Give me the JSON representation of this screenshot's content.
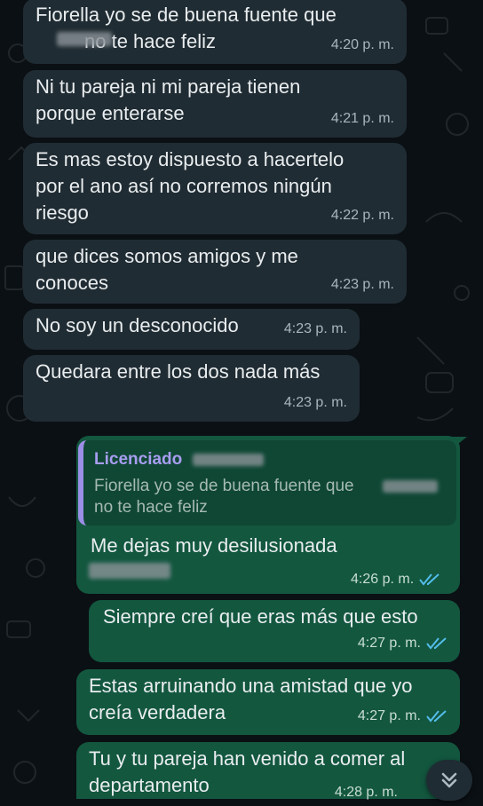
{
  "messages": [
    {
      "text": "Fiorella yo se de buena fuente que\n         no te hace feliz",
      "time": "4:20 p. m."
    },
    {
      "text": "Ni tu pareja ni mi pareja tienen\nporque enterarse",
      "time": "4:21 p. m."
    },
    {
      "text": "Es mas estoy dispuesto a hacertelo\npor el ano así no corremos ningún\nriesgo",
      "time": "4:22 p. m."
    },
    {
      "text": "que dices somos amigos y me\nconoces",
      "time": "4:23 p. m."
    },
    {
      "text": "No soy un desconocido",
      "time": "4:23 p. m."
    },
    {
      "text": "Quedara entre los dos nada más",
      "time": "4:23 p. m."
    }
  ],
  "reply": {
    "quoted_name": "Licenciado",
    "quoted_text": "Fiorella yo se de buena fuente que\nno te hace feliz",
    "text": "Me dejas muy desilusionada",
    "time": "4:26 p. m."
  },
  "outgoing": [
    {
      "text": "Siempre creí que eras más que esto",
      "time": "4:27 p. m."
    },
    {
      "text": "Estas arruinando una amistad que yo\ncreía verdadera",
      "time": "4:27 p. m."
    },
    {
      "text": "Tu y tu pareja han venido a comer al\ndepartamento",
      "time": "4:28 p. m."
    }
  ],
  "colors": {
    "incoming_bubble": "#202c33",
    "outgoing_bubble": "#13573f",
    "read_ticks": "#53bdeb",
    "quote_accent": "#9b8ee6"
  },
  "icons": {
    "read_receipt": "double-check-icon",
    "scroll_down": "chevron-double-down-icon"
  }
}
